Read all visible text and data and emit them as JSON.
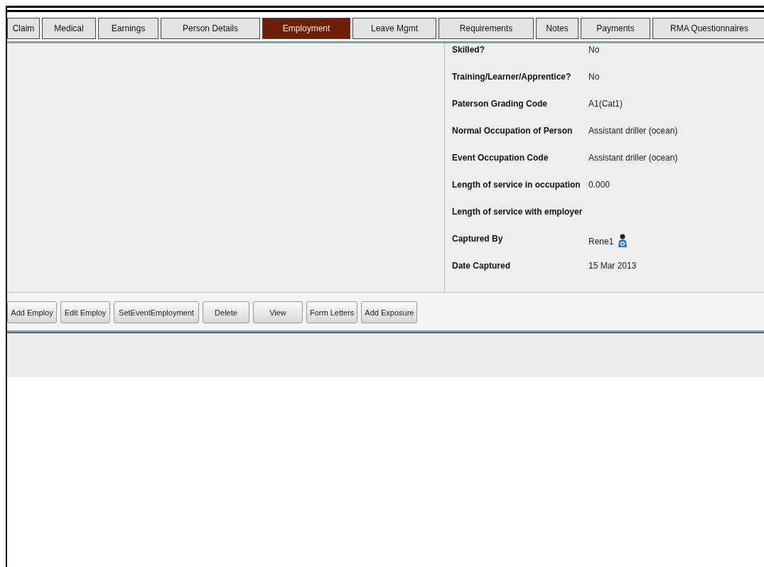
{
  "tabs": [
    {
      "label": "Claim",
      "selected": false
    },
    {
      "label": "Medical",
      "selected": false
    },
    {
      "label": "Earnings",
      "selected": false
    },
    {
      "label": "Person Details",
      "selected": false
    },
    {
      "label": "Employment",
      "selected": true
    },
    {
      "label": "Leave Mgmt",
      "selected": false
    },
    {
      "label": "Requirements",
      "selected": false
    },
    {
      "label": "Notes",
      "selected": false
    },
    {
      "label": "Payments",
      "selected": false
    },
    {
      "label": "RMA Questionnaires",
      "selected": false
    }
  ],
  "details": [
    {
      "label": "Skilled?",
      "value": "No"
    },
    {
      "label": "Training/Learner/Apprentice?",
      "value": "No"
    },
    {
      "label": "Paterson Grading Code",
      "value": "A1(Cat1)"
    },
    {
      "label": "Normal Occupation of Person",
      "value": "Assistant driller (ocean)"
    },
    {
      "label": "Event Occupation Code",
      "value": "Assistant driller (ocean)"
    },
    {
      "label": "Length of service in occupation",
      "value": "0.000"
    },
    {
      "label": "Length of service with employer"
    },
    {
      "label": "Captured By",
      "value": "Rene1",
      "kind": "user"
    },
    {
      "label": "Date Captured",
      "value": "15 Mar 2013"
    }
  ],
  "buttons": [
    "Add Employ",
    "Edit Employ",
    "SetEventEmployment",
    "Delete",
    "View",
    "Form Letters",
    "Add Exposure"
  ]
}
